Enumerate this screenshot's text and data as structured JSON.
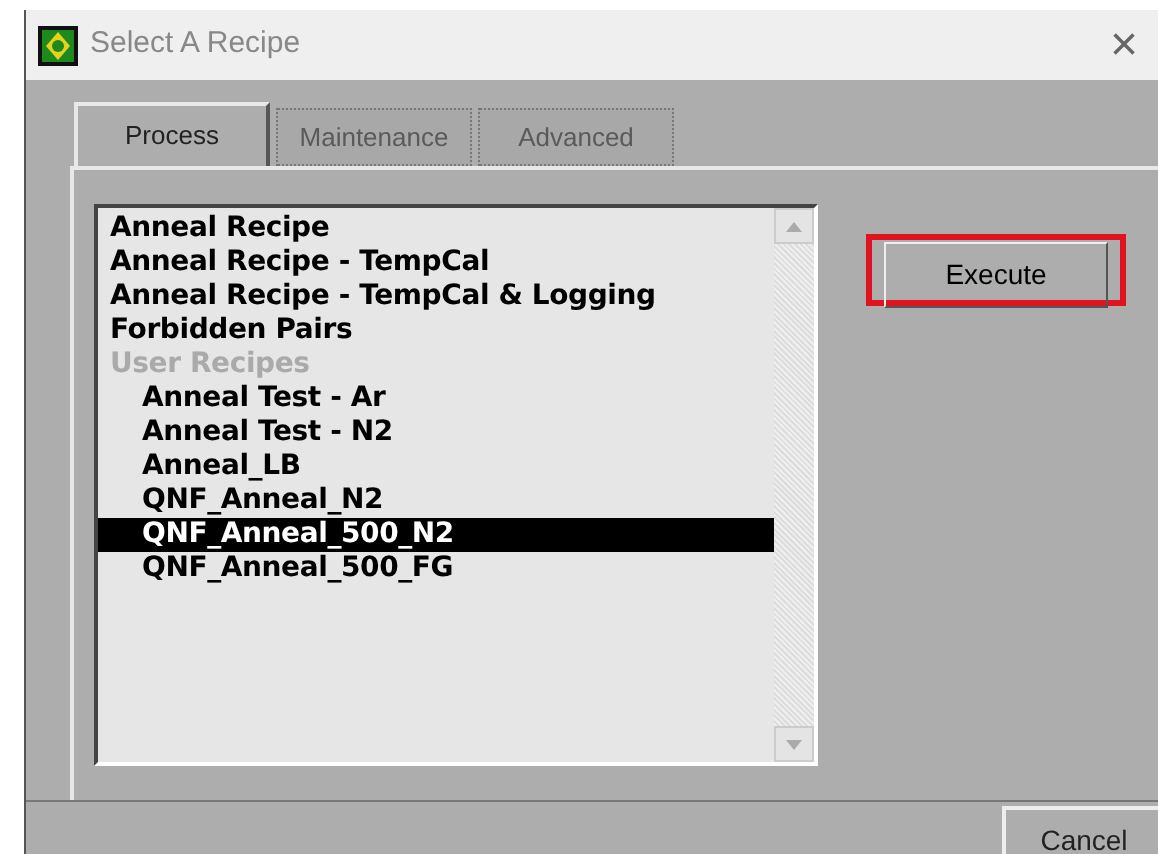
{
  "window": {
    "title": "Select A Recipe",
    "close": "×"
  },
  "tabs": [
    {
      "label": "Process",
      "selected": true,
      "disabled": false
    },
    {
      "label": "Maintenance",
      "selected": false,
      "disabled": true
    },
    {
      "label": "Advanced",
      "selected": false,
      "disabled": true
    }
  ],
  "recipes": [
    {
      "label": "Anneal Recipe",
      "kind": "recipe",
      "selected": false
    },
    {
      "label": "Anneal Recipe - TempCal",
      "kind": "recipe",
      "selected": false
    },
    {
      "label": "Anneal Recipe - TempCal & Logging",
      "kind": "recipe",
      "selected": false
    },
    {
      "label": "Forbidden Pairs",
      "kind": "recipe",
      "selected": false
    },
    {
      "label": "User Recipes",
      "kind": "group",
      "selected": false,
      "children": [
        {
          "label": "Anneal Test - Ar",
          "kind": "recipe",
          "selected": false
        },
        {
          "label": "Anneal Test - N2",
          "kind": "recipe",
          "selected": false
        },
        {
          "label": "Anneal_LB",
          "kind": "recipe",
          "selected": false
        },
        {
          "label": "QNF_Anneal_N2",
          "kind": "recipe",
          "selected": false
        },
        {
          "label": "QNF_Anneal_500_N2",
          "kind": "recipe",
          "selected": true
        },
        {
          "label": "QNF_Anneal_500_FG",
          "kind": "recipe",
          "selected": false
        }
      ]
    }
  ],
  "buttons": [
    {
      "label": "Execute",
      "highlighted": true
    },
    {
      "label": "Cancel",
      "highlighted": false
    }
  ]
}
